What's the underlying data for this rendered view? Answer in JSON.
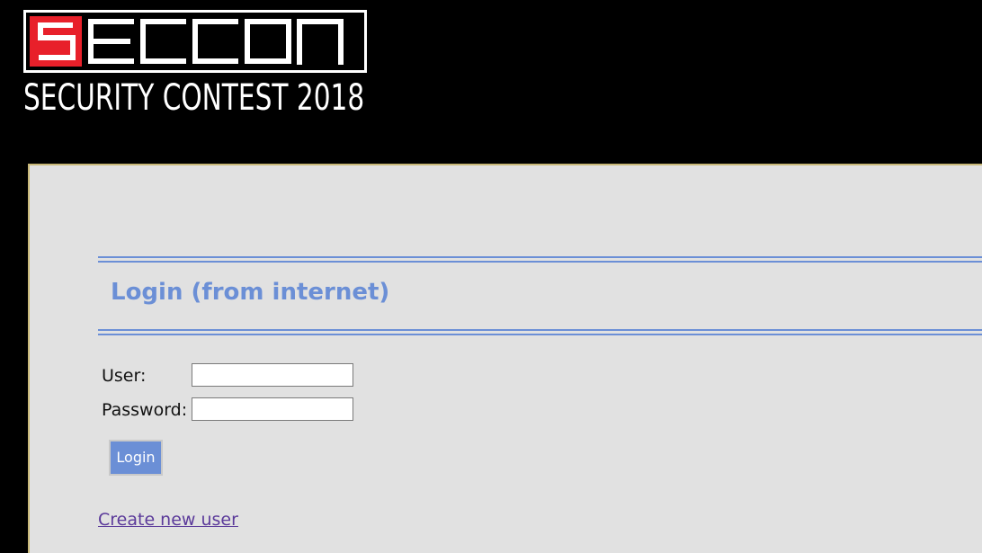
{
  "header": {
    "logo_text": "SECCON",
    "logo_subtitle": "SECURITY CONTEST 2018",
    "logo_colors": {
      "accent": "#e8202a",
      "outline": "#ffffff"
    }
  },
  "login": {
    "heading": "Login (from internet)",
    "user_label": "User:",
    "user_value": "",
    "password_label": "Password:",
    "password_value": "",
    "submit_label": "Login",
    "create_user_link": "Create new user"
  },
  "colors": {
    "background": "#000000",
    "panel": "#e1e1e1",
    "panel_border": "#c8b878",
    "accent_blue": "#6b8fd6",
    "link": "#5b3a9a"
  }
}
